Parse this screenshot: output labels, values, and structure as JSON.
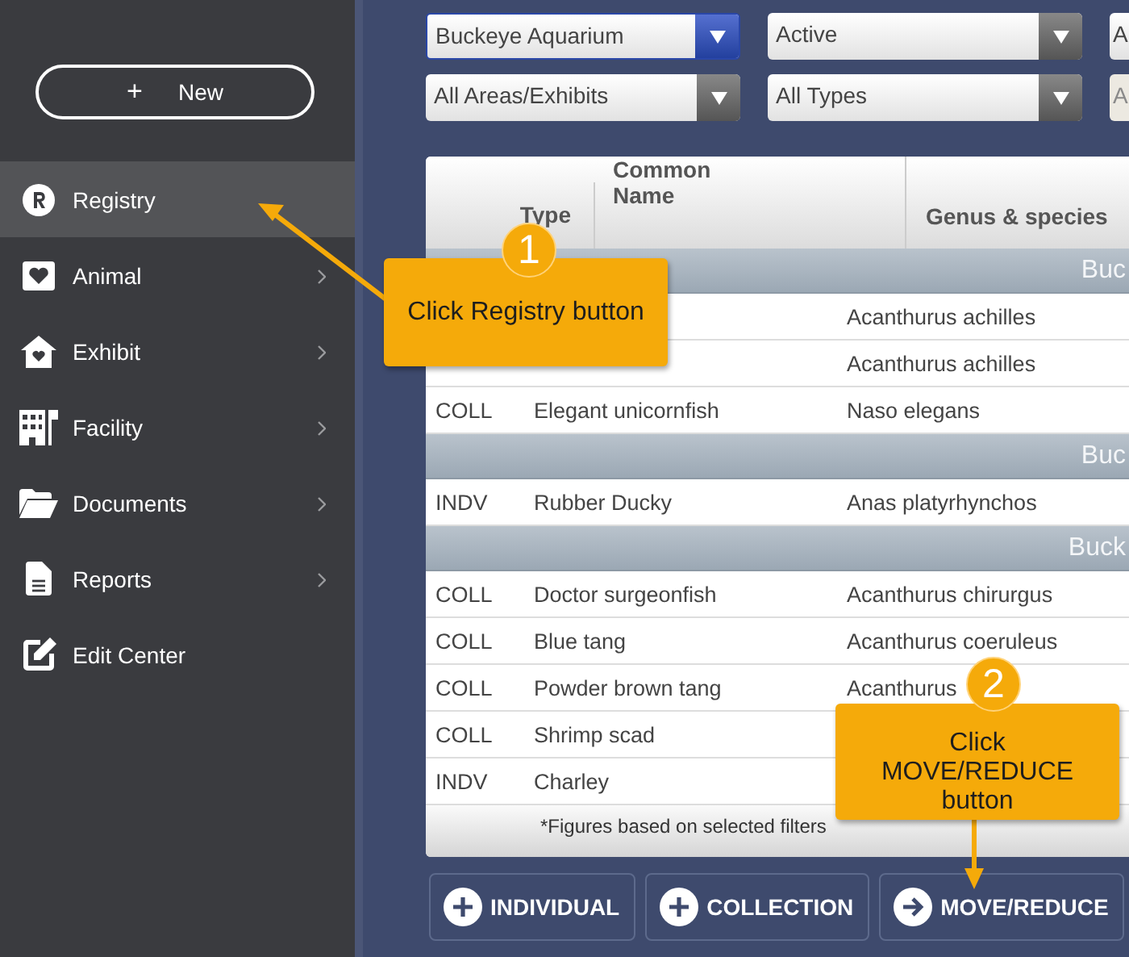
{
  "sidebar": {
    "new_button": {
      "icon": "+",
      "label": "New"
    },
    "items": [
      {
        "label": "Registry",
        "selected": true,
        "expandable": false
      },
      {
        "label": "Animal",
        "selected": false,
        "expandable": true
      },
      {
        "label": "Exhibit",
        "selected": false,
        "expandable": true
      },
      {
        "label": "Facility",
        "selected": false,
        "expandable": true
      },
      {
        "label": "Documents",
        "selected": false,
        "expandable": true
      },
      {
        "label": "Reports",
        "selected": false,
        "expandable": true
      },
      {
        "label": "Edit Center",
        "selected": false,
        "expandable": false
      }
    ]
  },
  "filter_rows": [
    {
      "dropdowns": [
        {
          "value": "Buckeye Aquarium",
          "focused": true,
          "disabled": false
        },
        {
          "value": "Active",
          "focused": false,
          "disabled": false
        },
        {
          "value": "A",
          "focused": false,
          "disabled": false
        }
      ]
    },
    {
      "dropdowns": [
        {
          "value": "All Areas/Exhibits",
          "focused": false,
          "disabled": false
        },
        {
          "value": "All Types",
          "focused": false,
          "disabled": false
        },
        {
          "value": "A",
          "focused": false,
          "disabled": true
        }
      ]
    }
  ],
  "table": {
    "columns": [
      "Type",
      "Common Name",
      "Genus & species"
    ],
    "groups": [
      {
        "label": "Buc",
        "rows": [
          {
            "genus": "Acanthurus achilles"
          },
          {
            "genus": "Acanthurus achilles"
          },
          {
            "type": "COLL",
            "common_name": "Elegant unicornfish",
            "genus": "Naso elegans"
          }
        ]
      },
      {
        "label": "Buc",
        "rows": [
          {
            "type": "INDV",
            "common_name": "Rubber Ducky",
            "genus": "Anas platyrhynchos"
          }
        ]
      },
      {
        "label": "Buck",
        "rows": [
          {
            "type": "COLL",
            "common_name": "Doctor surgeonfish",
            "genus": "Acanthurus chirurgus"
          },
          {
            "type": "COLL",
            "common_name": "Blue tang",
            "genus": "Acanthurus coeruleus"
          },
          {
            "type": "COLL",
            "common_name": "Powder brown tang",
            "genus": "Acanthurus"
          },
          {
            "type": "COLL",
            "common_name": "Shrimp scad"
          },
          {
            "type": "INDV",
            "common_name": "Charley"
          }
        ]
      }
    ],
    "footnote": "*Figures based on selected filters"
  },
  "actions": [
    {
      "label": "INDIVIDUAL",
      "kind": "add"
    },
    {
      "label": "COLLECTION",
      "kind": "add"
    },
    {
      "label": "MOVE/REDUCE",
      "kind": "move"
    }
  ],
  "callouts": [
    {
      "number": "1",
      "text": "Click Registry button"
    },
    {
      "number": "2",
      "text": "Click MOVE/REDUCE button"
    }
  ]
}
